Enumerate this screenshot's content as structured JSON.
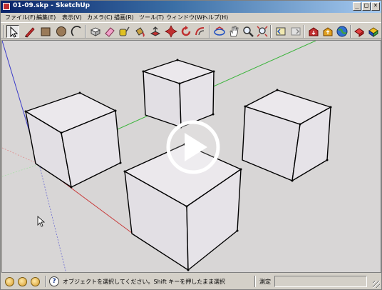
{
  "window": {
    "title": "01-09.skp - SketchUp",
    "minimize_glyph": "_",
    "maximize_glyph": "□",
    "close_glyph": "×"
  },
  "menu": [
    {
      "label": "ファイル(F)"
    },
    {
      "label": "編集(E)"
    },
    {
      "label": "表示(V)"
    },
    {
      "label": "カメラ(C)"
    },
    {
      "label": "描画(R)"
    },
    {
      "label": "ツール(T)"
    },
    {
      "label": "ウィンドウ(W)"
    },
    {
      "label": "ヘルプ(H)"
    }
  ],
  "toolbar": {
    "tools": [
      {
        "name": "select-tool",
        "icon": "arrow-icon",
        "active": true
      },
      {
        "name": "line-tool",
        "icon": "pencil-icon"
      },
      {
        "name": "rectangle-tool",
        "icon": "rectangle-icon"
      },
      {
        "name": "circle-tool",
        "icon": "circle-icon"
      },
      {
        "name": "arc-tool",
        "icon": "arc-icon"
      },
      {
        "name": "make-component-tool",
        "icon": "component-icon"
      },
      {
        "name": "eraser-tool",
        "icon": "eraser-icon"
      },
      {
        "name": "tape-measure-tool",
        "icon": "tape-icon"
      },
      {
        "name": "paint-bucket-tool",
        "icon": "bucket-icon"
      },
      {
        "name": "push-pull-tool",
        "icon": "pushpull-icon"
      },
      {
        "name": "move-tool",
        "icon": "move-icon"
      },
      {
        "name": "rotate-tool",
        "icon": "rotate-icon"
      },
      {
        "name": "offset-tool",
        "icon": "offset-icon"
      },
      {
        "name": "orbit-tool",
        "icon": "orbit-icon"
      },
      {
        "name": "pan-tool",
        "icon": "hand-icon"
      },
      {
        "name": "zoom-tool",
        "icon": "magnifier-icon"
      },
      {
        "name": "zoom-extents-tool",
        "icon": "zoom-extents-icon"
      },
      {
        "name": "previous-view-tool",
        "icon": "previous-view-icon"
      },
      {
        "name": "next-view-tool",
        "icon": "next-view-icon"
      },
      {
        "name": "get-models-tool",
        "icon": "warehouse-icon"
      },
      {
        "name": "share-model-tool",
        "icon": "share-icon"
      },
      {
        "name": "google-earth-tool",
        "icon": "globe-icon"
      },
      {
        "name": "extension-warehouse-tool",
        "icon": "extension-icon"
      },
      {
        "name": "layout-tool",
        "icon": "layout-icon"
      }
    ]
  },
  "viewport": {
    "background": "#d8d6d6",
    "axis_red": "#c83c3c",
    "axis_green": "#3cb43c",
    "axis_blue": "#3c3cc8",
    "face_color": "#e6e2e8",
    "edge_color": "#000000",
    "play_overlay": "play-icon"
  },
  "status": {
    "message": "オブジェクトを選択してください。Shift キーを押したまま選択",
    "measure_label": "測定",
    "measure_value": ""
  }
}
